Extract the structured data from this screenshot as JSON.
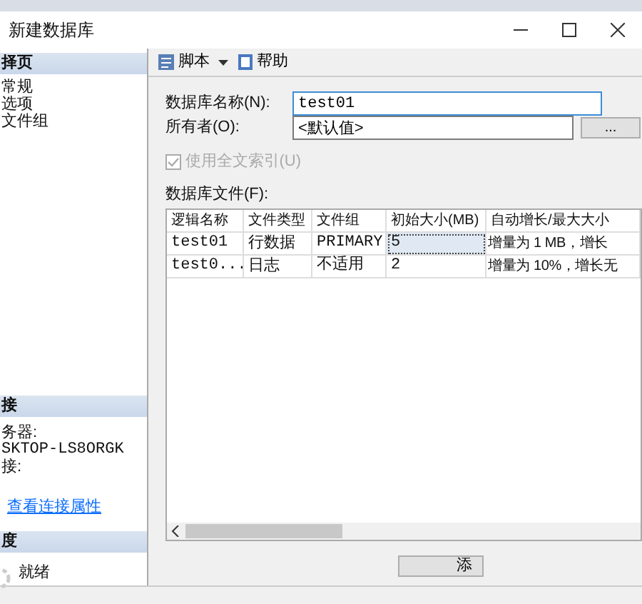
{
  "window": {
    "title": "新建数据库"
  },
  "sidebar": {
    "pages_header": "择页",
    "pages": [
      {
        "label": "常规"
      },
      {
        "label": "选项"
      },
      {
        "label": "文件组"
      }
    ],
    "connection_header": "接",
    "connection_lines": [
      "务器:",
      "SKTOP-LS8ORGK",
      "接:"
    ],
    "connection_link": "查看连接属性",
    "progress_header": "度",
    "progress_status": "就绪"
  },
  "toolbar": {
    "script": "脚本",
    "help": "帮助"
  },
  "form": {
    "name_label": "数据库名称(N):",
    "name_value": "test01",
    "owner_label": "所有者(O):",
    "owner_value": "<默认值>",
    "owner_button": "...",
    "fulltext": {
      "label": "使用全文索引(U)",
      "checked": true,
      "disabled": true
    }
  },
  "files": {
    "label": "数据库文件(F):",
    "columns": [
      "逻辑名称",
      "文件类型",
      "文件组",
      "初始大小(MB)",
      "自动增长/最大大小"
    ],
    "rows": [
      {
        "cells": [
          {
            "text": "test01",
            "focused": false
          },
          {
            "text": "行数据",
            "focused": false
          },
          {
            "text": "PRIMARY",
            "focused": false
          },
          {
            "text": "5",
            "focused": true
          },
          {
            "text": "增量为 1 MB，增长",
            "focused": false
          }
        ]
      },
      {
        "cells": [
          {
            "text": "test0...",
            "focused": false
          },
          {
            "text": "日志",
            "focused": false
          },
          {
            "text": "不适用",
            "focused": false
          },
          {
            "text": "2",
            "focused": false
          },
          {
            "text": "增量为 10%，增长无",
            "focused": false
          }
        ]
      }
    ]
  },
  "add_button": "添"
}
